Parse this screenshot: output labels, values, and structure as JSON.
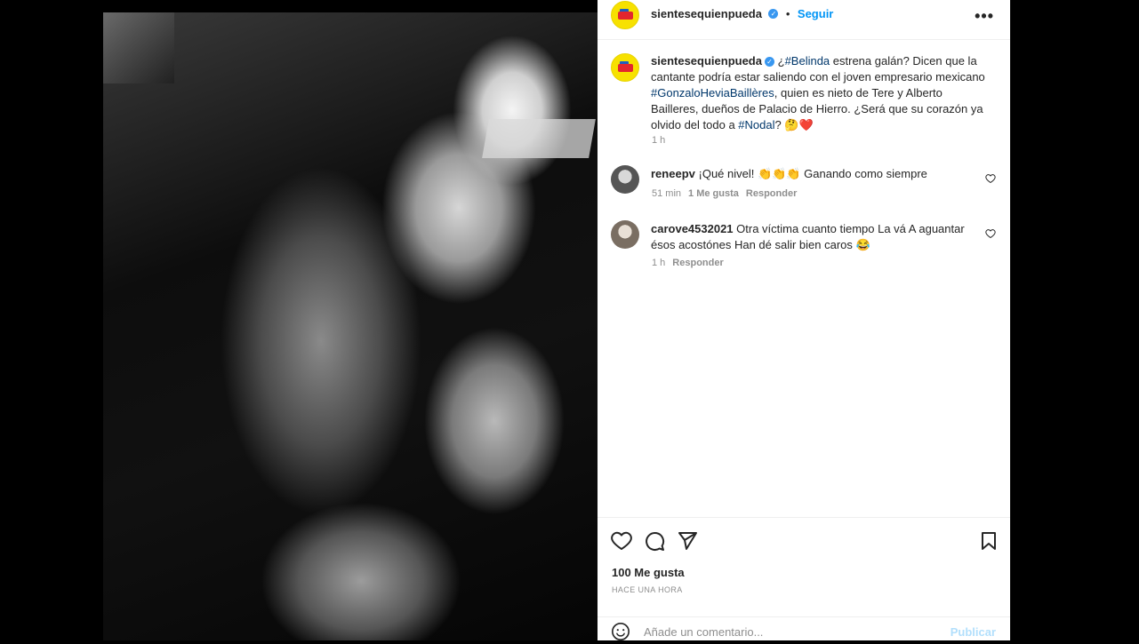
{
  "post": {
    "account": "sientesequienpueda",
    "follow_label": "Seguir",
    "dot": "•",
    "more": "•••",
    "caption": {
      "username": "sientesequienpueda",
      "p1": "¿",
      "tag1": "#Belinda",
      "p2": " estrena galán? Dicen que la cantante podría estar saliendo con el joven empresario mexicano ",
      "tag2": "#GonzaloHeviaBaillères",
      "p3": ", quien es nieto de Tere y Alberto Bailleres, dueños de Palacio de Hierro. ¿Será que su corazón ya olvido del todo a ",
      "tag3": "#Nodal",
      "p4": "?",
      "emojis": "🤔❤️",
      "time": "1 h"
    },
    "comments": [
      {
        "username": "reneepv",
        "text": "¡Qué nivel! 👏👏👏 Ganando como siempre",
        "time": "51 min",
        "likes": "1 Me gusta",
        "reply": "Responder"
      },
      {
        "username": "carove4532021",
        "text": "Otra víctima cuanto tiempo La vá A aguantar ésos acostónes Han dé salir bien caros 😂",
        "time": "1 h",
        "reply": "Responder"
      }
    ],
    "likes_count": "100 Me gusta",
    "posted_ago": "HACE UNA HORA",
    "comment_placeholder": "Añade un comentario...",
    "publish_label": "Publicar",
    "icons": [
      "heart-icon",
      "comment-icon",
      "share-icon",
      "bookmark-icon",
      "emoji-icon",
      "verified-badge-icon",
      "more-options-icon"
    ],
    "colors": {
      "link": "#0095f6",
      "hashtag": "#00376b",
      "verified": "#3897f0",
      "publish_disabled": "#b2dffc",
      "brand_yellow": "#f7e100"
    }
  }
}
